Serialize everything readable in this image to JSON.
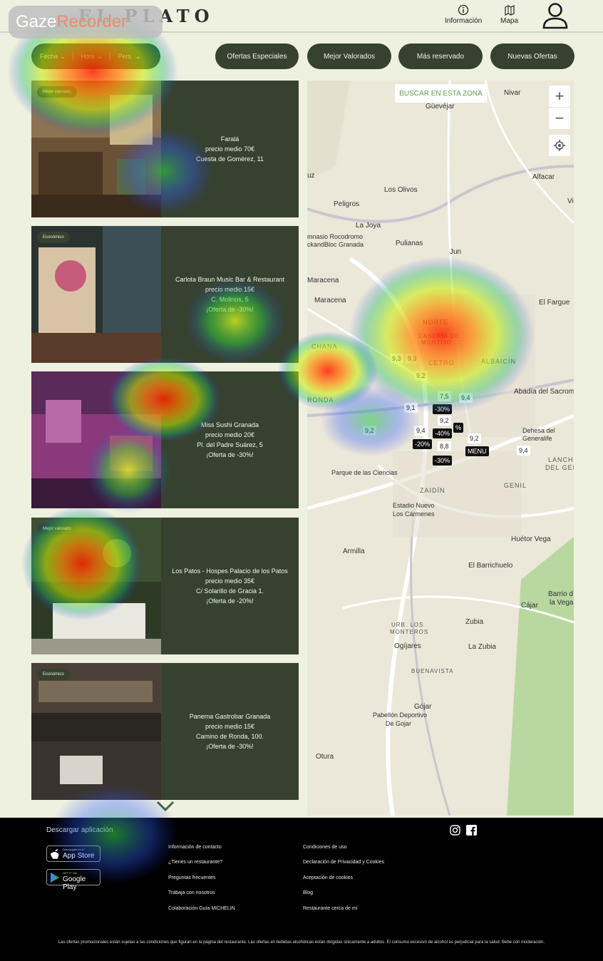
{
  "overlay": {
    "gaze_prefix": "Gaze",
    "gaze_suffix": "Recorder"
  },
  "header": {
    "logo": "EL PLATO",
    "info_label": "Información",
    "map_label": "Mapa"
  },
  "filters": {
    "options": [
      "Fecha",
      "Hora",
      "Pers."
    ],
    "buttons": [
      "Ofertas Especiales",
      "Mejor Valorados",
      "Más reservado",
      "Nuevas Ofertas"
    ]
  },
  "restaurants": [
    {
      "tag": "Mejor valorado",
      "lines": [
        "Faralá",
        "precio medio 70€",
        "Cuesta de Gomérez, 11",
        ""
      ]
    },
    {
      "tag": "Económico",
      "lines": [
        "Carlota Braun Music Bar & Restaurant",
        "precio medio 15€",
        "C. Molinos, 5",
        "¡Oferta de -30%!"
      ]
    },
    {
      "tag": "",
      "lines": [
        "Miss Sushi Granada",
        "precio medio 20€",
        "Pl. del Padre Suárez, 5",
        "¡Oferta de -30%!"
      ]
    },
    {
      "tag": "Mejor valorado",
      "lines": [
        "Los Patos - Hospes Palacio de los Patos",
        "precio medio 35€",
        "C/ Solarillo de Gracia 1.",
        "¡Oferta de -20%!"
      ]
    },
    {
      "tag": "Económico",
      "lines": [
        "Panema Gastrobar Granada",
        "precio medio 15€",
        "Camino de Ronda, 100.",
        "¡Oferta de -30%!"
      ]
    }
  ],
  "map": {
    "search_zone": "BUSCAR EN ESTA ZONA",
    "zoom_in": "+",
    "zoom_out": "−",
    "places": {
      "nivar": "Nivar",
      "guevejar": "Güevéjar",
      "alfacar": "Alfacar",
      "los_olivos": "Los Olivos",
      "peligros": "Peligros",
      "la_joya": "La Joya",
      "gimnasio": "mnasio Rocodromo",
      "blocgranada": "ckandBloc Granada",
      "pulianas": "Pulianas",
      "jun": "Jun",
      "maracena": "Maracena",
      "el_fargue": "El Fargue",
      "norte": "NORTE",
      "caseria": "CASERÍA DE",
      "montijo": "MONTIJO",
      "albaicin": "ALBAICÍN",
      "chana": "CHANA",
      "ronda": "RONDA",
      "cetro": "CETRO",
      "abadia": "Abadía del Sacrom",
      "dehesa": "Dehesa del",
      "generalife": "Generalife",
      "lancha": "LANCH",
      "del_gen": "DEL GEN",
      "parque": "Parque de las Ciencias",
      "zaidin": "ZAIDÍN",
      "genil": "GENIL",
      "estadio": "Estadio Nuevo",
      "carmenes": "Los Cármenes",
      "huetor": "Huétor Vega",
      "armilla": "Armilla",
      "barrichuelo": "El Barrichuelo",
      "barrio": "Barrio d",
      "la_vega": "la Vega",
      "cajar": "Cájar",
      "urb": "URB. LOS",
      "monteros": "MONTEROS",
      "ogijares": "Ogíjares",
      "zubia": "Zubia",
      "la_zubia": "La Zubia",
      "buenavista": "BUENAVISTA",
      "gojar": "Gójar",
      "pabellon": "Pabellón Deportivo",
      "de_gojar": "De Gojar",
      "otura": "Otura",
      "vi": "Vi",
      "uz": "uz"
    },
    "ratings": [
      "9,3",
      "9,3",
      "9,2",
      "7,5",
      "9,4",
      "9,1",
      "9,2",
      "9,2",
      "9,4",
      "8,8",
      "9,2",
      "9,4",
      "9,2"
    ],
    "offers": [
      "-30%",
      "-40%",
      "-20%",
      "-30%",
      "MENU",
      "%"
    ]
  },
  "footer": {
    "download_title": "Descargar aplicación",
    "app_store_sub": "Descárgalo en el",
    "app_store": "App Store",
    "google_sub": "GET IT ON",
    "google_play": "Google Play",
    "col1": [
      "Información de contacto",
      "¿Tienes un restaurante?",
      "Preguntas frecuentes",
      "Trabaja con nosotros",
      "Colaboración Guía MICHELIN"
    ],
    "col2": [
      "Condiciones de uso",
      "Declaración de Privacidad y Cookies",
      "Aceptación de cookies",
      "Blog",
      "Restaurante cerca de mí"
    ],
    "disclaimer": "Las ofertas promocionales están sujetas a las condiciones que figuran en la página del restaurante. Las ofertas en bebidas alcohólicas están dirigidas únicamente a adultos. El consumo excesivo de alcohol es perjudicial para la salud. Bebe con moderación."
  },
  "colors": {
    "primary": "#36422f",
    "background": "#eef0e0",
    "footer": "#000000",
    "map_accent": "#5ea04a"
  }
}
